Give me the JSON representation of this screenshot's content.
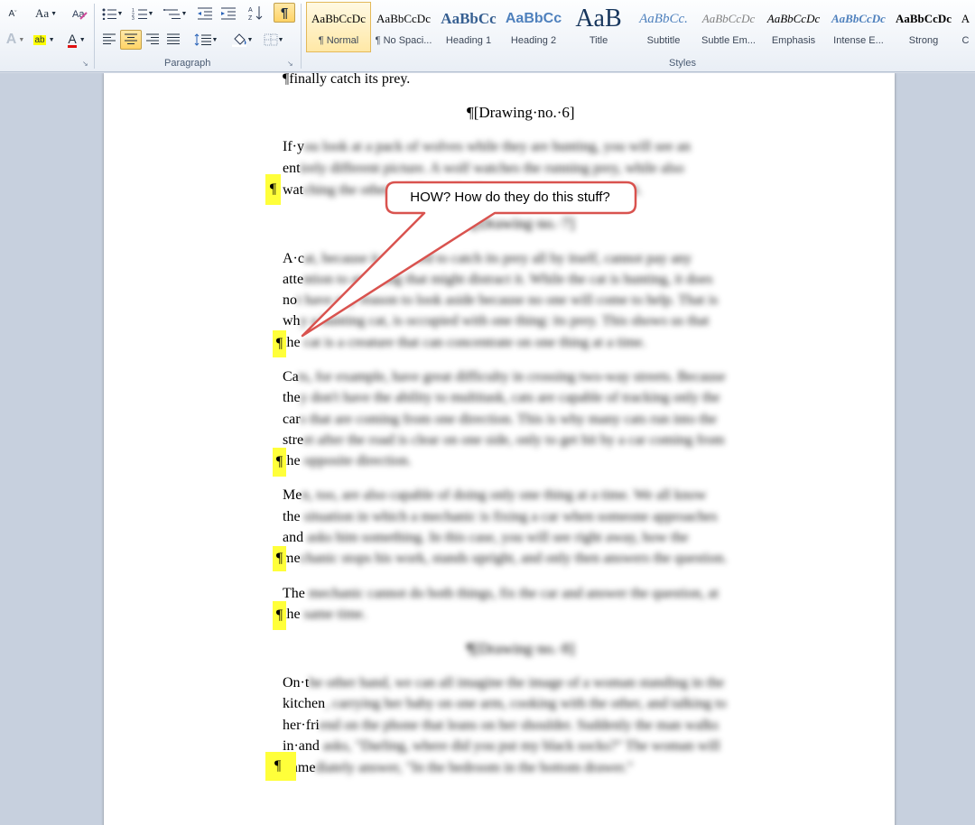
{
  "ribbon": {
    "paragraph_group_label": "Paragraph",
    "styles_group_label": "Styles",
    "font_size_smaller_label": "A",
    "change_case_label": "Aa",
    "highlight_label": "ab",
    "font_color_label": "A",
    "text_effects_label": "A",
    "show_marks_label": "¶",
    "styles": [
      {
        "preview": "AaBbCcDc",
        "name": "¶ Normal",
        "selected": true
      },
      {
        "preview": "AaBbCcDc",
        "name": "¶ No Spaci..."
      },
      {
        "preview": "AaBbCc",
        "name": "Heading 1"
      },
      {
        "preview": "AaBbCc",
        "name": "Heading 2"
      },
      {
        "preview": "AaB",
        "name": "Title"
      },
      {
        "preview": "AaBbCc.",
        "name": "Subtitle"
      },
      {
        "preview": "AaBbCcDc",
        "name": "Subtle Em..."
      },
      {
        "preview": "AaBbCcDc",
        "name": "Emphasis"
      },
      {
        "preview": "AaBbCcDc",
        "name": "Intense E..."
      },
      {
        "preview": "AaBbCcDc",
        "name": "Strong"
      },
      {
        "preview": "A",
        "name": "C"
      }
    ]
  },
  "document": {
    "top_fragment": "¶finally catch its prey.",
    "drawing_6": "¶[Drawing·no.·6]",
    "drawing_7": "¶[Drawing·no.·7]",
    "drawing_8": "¶[Drawing·no.·8]",
    "pilcrow": "¶",
    "lines": [
      {
        "pre": "If·y",
        "blur": "ou look at a pack of wolves while they are hunting, you will see an"
      },
      {
        "pre": "ent",
        "blur": "irely different picture. A wolf watches the running prey, while also"
      },
      {
        "pre": "wat",
        "blur": "ching the others of the pack who are running along with it."
      },
      {
        "pre": "A·c",
        "blur": "at, because it is forced to catch its prey all by itself, cannot pay any"
      },
      {
        "pre": "atte",
        "blur": "ntion to anything that might distract it. While the cat is hunting, it does"
      },
      {
        "pre": "no",
        "blur": "t have any reason to look aside because no one will come to help. That is"
      },
      {
        "pre": "wh",
        "blur": "y a hunting cat, is occupied with one thing: its prey. This shows us that"
      },
      {
        "pre": "the",
        "blur": " cat is a creature that can concentrate on one thing at a time."
      },
      {
        "pre": "Ca",
        "blur": "ts, for example, have great difficulty in crossing two-way streets. Because"
      },
      {
        "pre": "the",
        "blur": "y don't have the ability to multitask, cats are capable of tracking only the"
      },
      {
        "pre": "car",
        "blur": "s that are coming from one direction. This is why many cats run into the"
      },
      {
        "pre": "stre",
        "blur": "et after the road is clear on one side, only to get hit by a car coming from"
      },
      {
        "pre": "the",
        "blur": " opposite direction."
      },
      {
        "pre": "Me",
        "blur": "n, too, are also capable of doing only one thing at a time. We all know"
      },
      {
        "pre": "the",
        "blur": " situation in which a mechanic is fixing a car when someone approaches"
      },
      {
        "pre": "and",
        "blur": " asks him something. In this case, you will see right away, how the"
      },
      {
        "pre": "me",
        "blur": "chanic stops his work, stands upright, and only then answers the question."
      },
      {
        "pre": "The",
        "blur": " mechanic cannot do both things, fix the car and answer the question, at"
      },
      {
        "pre": "the",
        "blur": " same time."
      },
      {
        "pre": "On·t",
        "blur": "he other hand, we can all imagine the image of a woman standing in the"
      },
      {
        "pre": "kitchen",
        "blur": ", carrying her baby on one arm, cooking with the other, and talking to"
      },
      {
        "pre": "her·fri",
        "blur": "end on the phone that leans on her shoulder. Suddenly the man walks"
      },
      {
        "pre": "in·and",
        "blur": " asks, \"Darling, where did you put my black socks?\" The woman will"
      },
      {
        "pre": "imme",
        "blur": "diately answer, \"In the bedroom in the bottom drawer.\""
      }
    ]
  },
  "callout": {
    "text": "HOW?  How do they do this stuff?"
  }
}
